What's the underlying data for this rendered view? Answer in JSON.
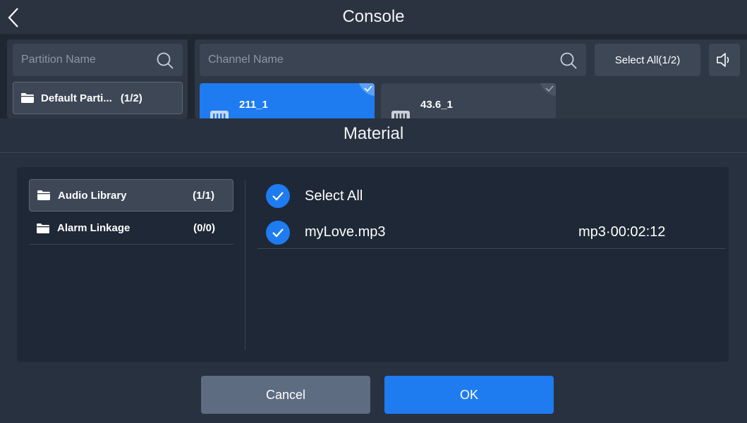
{
  "header": {
    "title": "Console"
  },
  "partitions": {
    "search_placeholder": "Partition Name",
    "items": [
      {
        "label": "Default Parti...",
        "count": "(1/2)"
      }
    ]
  },
  "channels": {
    "search_placeholder": "Channel Name",
    "select_all_label": "Select All(1/2)",
    "items": [
      {
        "name": "211_1",
        "selected": true
      },
      {
        "name": "43.6_1",
        "selected": false
      }
    ]
  },
  "material": {
    "title": "Material",
    "libraries": [
      {
        "label": "Audio Library",
        "count": "(1/1)",
        "active": true
      },
      {
        "label": "Alarm Linkage",
        "count": "(0/0)",
        "active": false
      }
    ],
    "select_all_label": "Select All",
    "files": [
      {
        "name": "myLove.mp3",
        "meta": "mp3·00:02:12",
        "checked": true
      }
    ],
    "cancel_label": "Cancel",
    "ok_label": "OK"
  },
  "colors": {
    "accent": "#1f7bf0",
    "background": "#1f2733",
    "panel": "#2e3744",
    "dialog": "#283140",
    "cancel": "#5d6c80"
  },
  "icons": {
    "back": "chevron-left-icon",
    "search": "search-icon",
    "speaker": "speaker-icon",
    "folder": "folder-icon",
    "check": "check-icon",
    "device": "device-icon"
  }
}
